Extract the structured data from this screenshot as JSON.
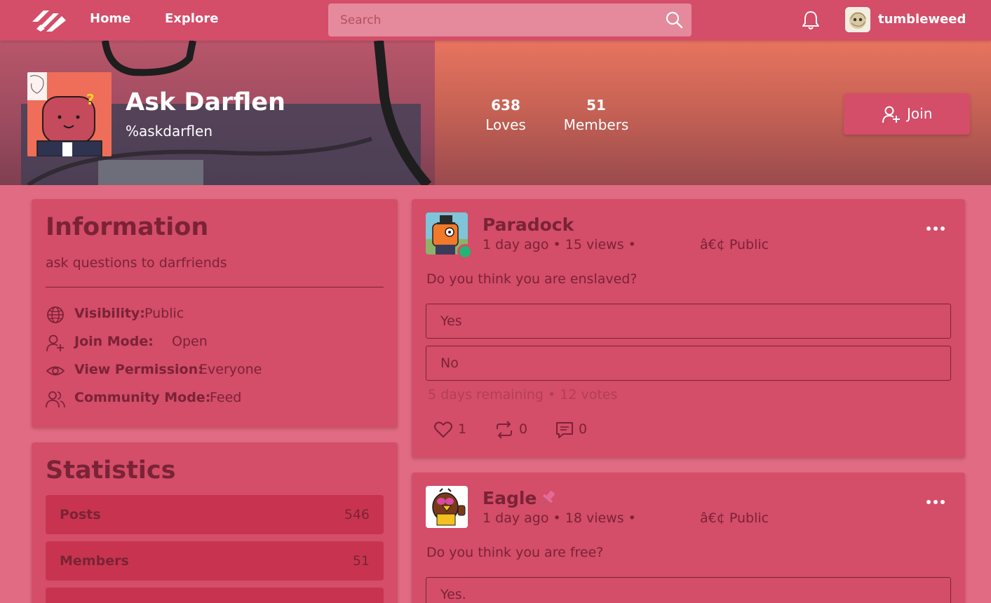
{
  "nav": {
    "home": "Home",
    "explore": "Explore",
    "search_placeholder": "Search",
    "username": "tumbleweed"
  },
  "community": {
    "title": "Ask Darflen",
    "handle": "%askdarflen",
    "loves_value": "638",
    "loves_label": "Loves",
    "members_value": "51",
    "members_label": "Members",
    "join_label": "Join"
  },
  "information": {
    "heading": "Information",
    "description": "ask questions to darfriends",
    "rows": [
      {
        "key": "Visibility:",
        "value": "Public",
        "icon": "globe-icon"
      },
      {
        "key": "Join Mode:",
        "value": "Open",
        "icon": "user-plus-icon"
      },
      {
        "key": "View Permission:",
        "value": "Everyone",
        "icon": "eye-icon"
      },
      {
        "key": "Community Mode:",
        "value": "Feed",
        "icon": "users-icon"
      }
    ]
  },
  "statistics": {
    "heading": "Statistics",
    "rows": [
      {
        "key": "Posts",
        "value": "546"
      },
      {
        "key": "Members",
        "value": "51"
      }
    ]
  },
  "posts": [
    {
      "author": "Paradock",
      "meta": "1 day ago • 15 views •",
      "visibility": "â€¢ Public",
      "text": "Do you think you are enslaved?",
      "options": [
        "Yes",
        "No"
      ],
      "poll_info": "5 days remaining • 12 votes",
      "likes": "1",
      "reposts": "0",
      "comments": "0"
    },
    {
      "author": "Eagle",
      "meta": "1 day ago • 18 views •",
      "visibility": "â€¢ Public",
      "text": "Do you think you are free?",
      "options": [
        "Yes."
      ]
    }
  ],
  "colors": {
    "page_bg": "#e06b82",
    "card_bg": "#d44d69",
    "text": "#7a2336",
    "online": "#22b573"
  }
}
